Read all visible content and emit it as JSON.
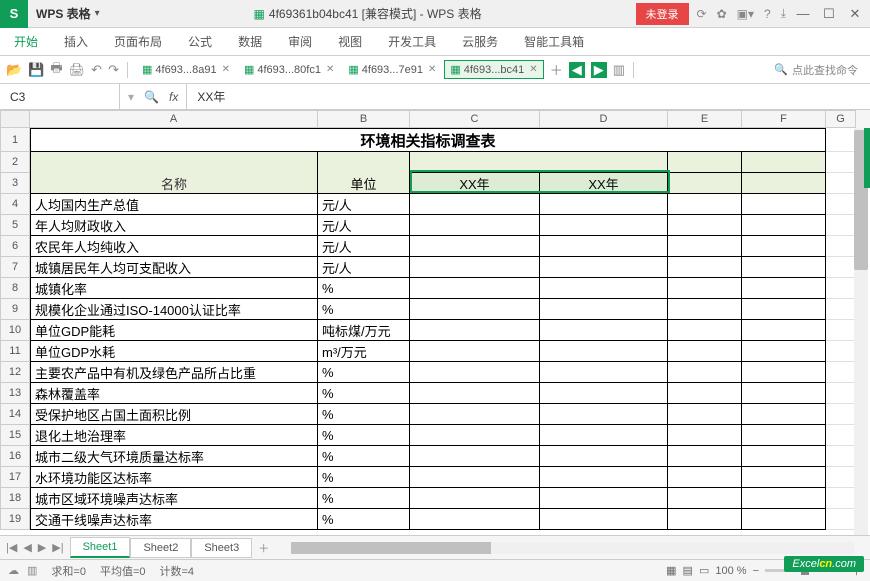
{
  "app": {
    "name": "WPS 表格",
    "doc_title": "4f69361b04bc41 [兼容模式] - WPS 表格",
    "login": "未登录"
  },
  "ribbon": {
    "tabs": [
      "开始",
      "插入",
      "页面布局",
      "公式",
      "数据",
      "审阅",
      "视图",
      "开发工具",
      "云服务",
      "智能工具箱"
    ]
  },
  "doc_tabs": [
    {
      "label": "4f693...8a91",
      "active": false
    },
    {
      "label": "4f693...80fc1",
      "active": false
    },
    {
      "label": "4f693...7e91",
      "active": false
    },
    {
      "label": "4f693...bc41",
      "active": true
    }
  ],
  "search": {
    "placeholder": "点此查找命令"
  },
  "formula": {
    "cell_ref": "C3",
    "value": "XX年"
  },
  "columns": [
    "A",
    "B",
    "C",
    "D",
    "E",
    "F",
    "G"
  ],
  "row_nums": [
    "1",
    "2",
    "3",
    "4",
    "5",
    "6",
    "7",
    "8",
    "9",
    "10",
    "11",
    "12",
    "13",
    "14",
    "15",
    "16",
    "17",
    "18",
    "19"
  ],
  "sheet": {
    "title": "环境相关指标调查表",
    "hdr_name": "名称",
    "hdr_unit": "单位",
    "hdr_year1": "XX年",
    "hdr_year2": "XX年",
    "rows": [
      {
        "name": "人均国内生产总值",
        "unit": "元/人"
      },
      {
        "name": "年人均财政收入",
        "unit": "元/人"
      },
      {
        "name": "农民年人均纯收入",
        "unit": "元/人"
      },
      {
        "name": "城镇居民年人均可支配收入",
        "unit": "元/人"
      },
      {
        "name": "城镇化率",
        "unit": "%"
      },
      {
        "name": "规模化企业通过ISO-14000认证比率",
        "unit": "%"
      },
      {
        "name": "单位GDP能耗",
        "unit": "吨标煤/万元"
      },
      {
        "name": "单位GDP水耗",
        "unit": "m³/万元"
      },
      {
        "name": "主要农产品中有机及绿色产品所占比重",
        "unit": "%"
      },
      {
        "name": "森林覆盖率",
        "unit": "%"
      },
      {
        "name": "受保护地区占国土面积比例",
        "unit": "%"
      },
      {
        "name": "退化土地治理率",
        "unit": "%"
      },
      {
        "name": "城市二级大气环境质量达标率",
        "unit": "%"
      },
      {
        "name": "水环境功能区达标率",
        "unit": "%"
      },
      {
        "name": "城市区域环境噪声达标率",
        "unit": "%"
      },
      {
        "name": "交通干线噪声达标率",
        "unit": "%"
      }
    ]
  },
  "sheets": [
    "Sheet1",
    "Sheet2",
    "Sheet3"
  ],
  "status": {
    "sum": "求和=0",
    "avg": "平均值=0",
    "count": "计数=4",
    "zoom": "100 %"
  },
  "watermark": {
    "a": "Excel",
    "b": "cn",
    "c": ".com"
  }
}
